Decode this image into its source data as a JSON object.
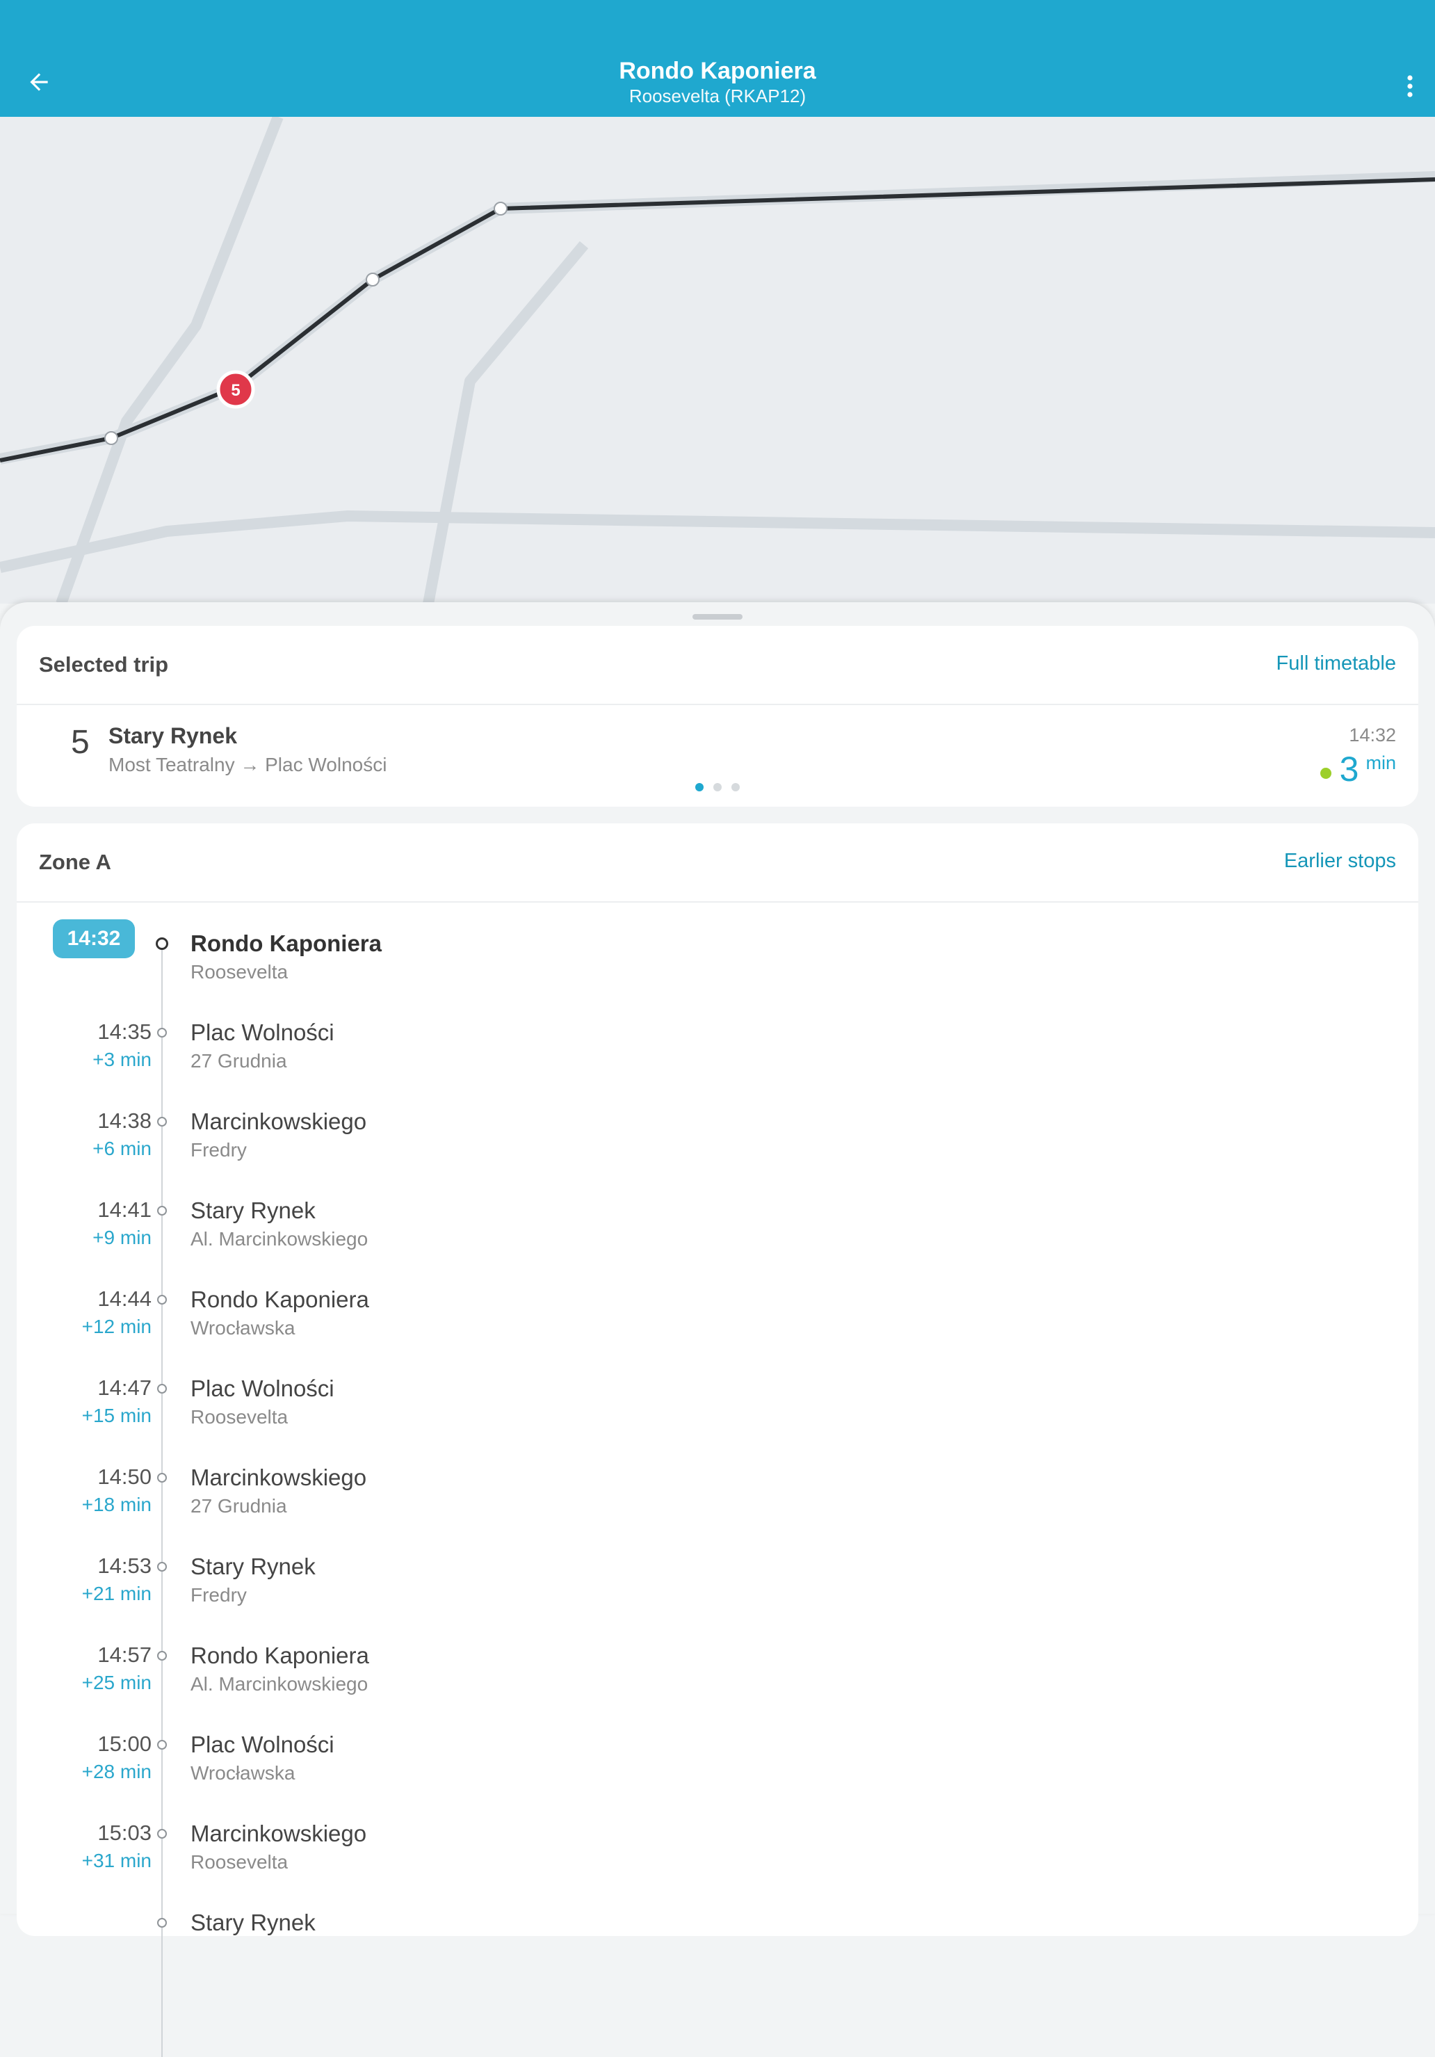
{
  "header": {
    "title": "Rondo Kaponiera",
    "subtitle": "Roosevelta (RKAP12)",
    "back_icon": "arrow-left-icon",
    "more_icon": "more-vertical-icon",
    "color": "#1fa8cf"
  },
  "map": {
    "vehicle_marker_label": "5",
    "vehicle_marker_color": "#e0384a"
  },
  "selected_trip": {
    "title": "Selected trip",
    "link": "Full timetable",
    "line": "5",
    "destination": "Stary Rynek",
    "route": "Most Teatralny → Plac Wolności",
    "time": "14:32",
    "eta_value": "3",
    "eta_unit": "min",
    "page_count": 3,
    "page_index": 1
  },
  "zone": {
    "title": "Zone A",
    "link": "Earlier stops",
    "stops": [
      {
        "time": "14:32",
        "delay": "",
        "name": "Rondo Kaponiera",
        "street": "Roosevelta",
        "current": true
      },
      {
        "time": "14:35",
        "delay": "+3 min",
        "name": "Plac Wolności",
        "street": "27 Grudnia"
      },
      {
        "time": "14:38",
        "delay": "+6 min",
        "name": "Marcinkowskiego",
        "street": "Fredry"
      },
      {
        "time": "14:41",
        "delay": "+9 min",
        "name": "Stary Rynek",
        "street": "Al. Marcinkowskiego"
      },
      {
        "time": "14:44",
        "delay": "+12 min",
        "name": "Rondo Kaponiera",
        "street": "Wrocławska"
      },
      {
        "time": "14:47",
        "delay": "+15 min",
        "name": "Plac Wolności",
        "street": "Roosevelta"
      },
      {
        "time": "14:50",
        "delay": "+18 min",
        "name": "Marcinkowskiego",
        "street": "27 Grudnia"
      },
      {
        "time": "14:53",
        "delay": "+21 min",
        "name": "Stary Rynek",
        "street": "Fredry"
      },
      {
        "time": "14:57",
        "delay": "+25 min",
        "name": "Rondo Kaponiera",
        "street": "Al. Marcinkowskiego"
      },
      {
        "time": "15:00",
        "delay": "+28 min",
        "name": "Plac Wolności",
        "street": "Wrocławska"
      },
      {
        "time": "15:03",
        "delay": "+31 min",
        "name": "Marcinkowskiego",
        "street": "Roosevelta"
      },
      {
        "time": "",
        "delay": "",
        "name": "Stary Rynek",
        "street": ""
      }
    ]
  }
}
